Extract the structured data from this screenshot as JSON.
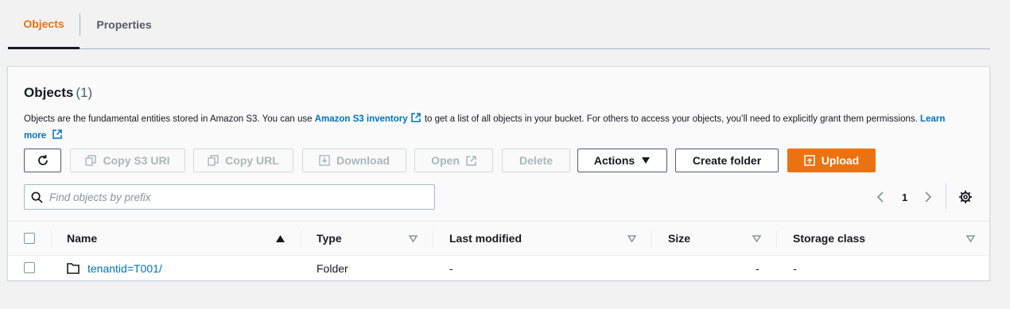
{
  "tabs": {
    "objects": "Objects",
    "properties": "Properties"
  },
  "header": {
    "title": "Objects",
    "count": "(1)",
    "desc_part1": "Objects are the fundamental entities stored in Amazon S3. You can use ",
    "inventory_link": "Amazon S3 inventory",
    "desc_part2": " to get a list of all objects in your bucket. For others to access your objects, you’ll need to explicitly grant them permissions. ",
    "learn_more": "Learn more"
  },
  "toolbar": {
    "copy_s3_uri": "Copy S3 URI",
    "copy_url": "Copy URL",
    "download": "Download",
    "open": "Open",
    "delete": "Delete",
    "actions": "Actions",
    "create_folder": "Create folder",
    "upload": "Upload"
  },
  "search": {
    "placeholder": "Find objects by prefix",
    "value": ""
  },
  "pagination": {
    "current_page": "1"
  },
  "table": {
    "columns": [
      "Name",
      "Type",
      "Last modified",
      "Size",
      "Storage class"
    ],
    "rows": [
      {
        "name": "tenantid=T001/",
        "type": "Folder",
        "last_modified": "-",
        "size": "-",
        "storage_class": "-"
      }
    ]
  },
  "colors": {
    "accent": "#ec7211",
    "link": "#0073bb",
    "text": "#16191f",
    "muted": "#545b64"
  }
}
